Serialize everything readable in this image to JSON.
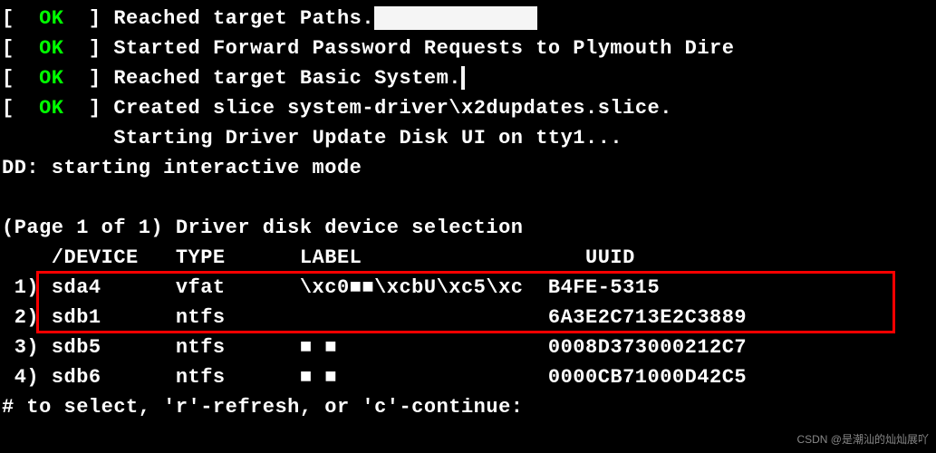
{
  "boot": {
    "lines": [
      {
        "prefix": "[  ",
        "status": "OK",
        "suffix": "  ] ",
        "message": "Reached target Paths.",
        "block_w": 180
      },
      {
        "prefix": "[  ",
        "status": "OK",
        "suffix": "  ] ",
        "message": "Started Forward Password Requests to Plymouth Dire",
        "block_w": 0
      },
      {
        "prefix": "[  ",
        "status": "OK",
        "suffix": "  ] ",
        "message": "Reached target Basic System.",
        "block_w": 4
      },
      {
        "prefix": "[  ",
        "status": "OK",
        "suffix": "  ] ",
        "message": "Created slice system-driver\\x2dupdates.slice.",
        "block_w": 0
      },
      {
        "prefix": "         ",
        "status": "",
        "suffix": "",
        "message": "Starting Driver Update Disk UI on tty1...",
        "block_w": 0
      },
      {
        "prefix": "",
        "status": "",
        "suffix": "",
        "message": "DD: starting interactive mode",
        "block_w": 0
      }
    ]
  },
  "selection": {
    "heading": "(Page 1 of 1) Driver disk device selection",
    "header": {
      "device": "/DEVICE",
      "type": "TYPE",
      "label": "LABEL",
      "uuid": "UUID"
    },
    "rows": [
      {
        "idx": "1)",
        "device": "sda4",
        "type": "vfat",
        "label": "\\xc0■■\\xcbU\\xc5\\xc",
        "uuid": "B4FE-5315"
      },
      {
        "idx": "2)",
        "device": "sdb1",
        "type": "ntfs",
        "label": "",
        "uuid": "6A3E2C713E2C3889"
      },
      {
        "idx": "3)",
        "device": "sdb5",
        "type": "ntfs",
        "label": "■ ■",
        "uuid": "0008D373000212C7"
      },
      {
        "idx": "4)",
        "device": "sdb6",
        "type": "ntfs",
        "label": "■ ■",
        "uuid": "0000CB71000D42C5"
      }
    ],
    "prompt": "# to select, 'r'-refresh, or 'c'-continue:"
  },
  "watermark": "CSDN @是潮汕的灿灿展吖"
}
